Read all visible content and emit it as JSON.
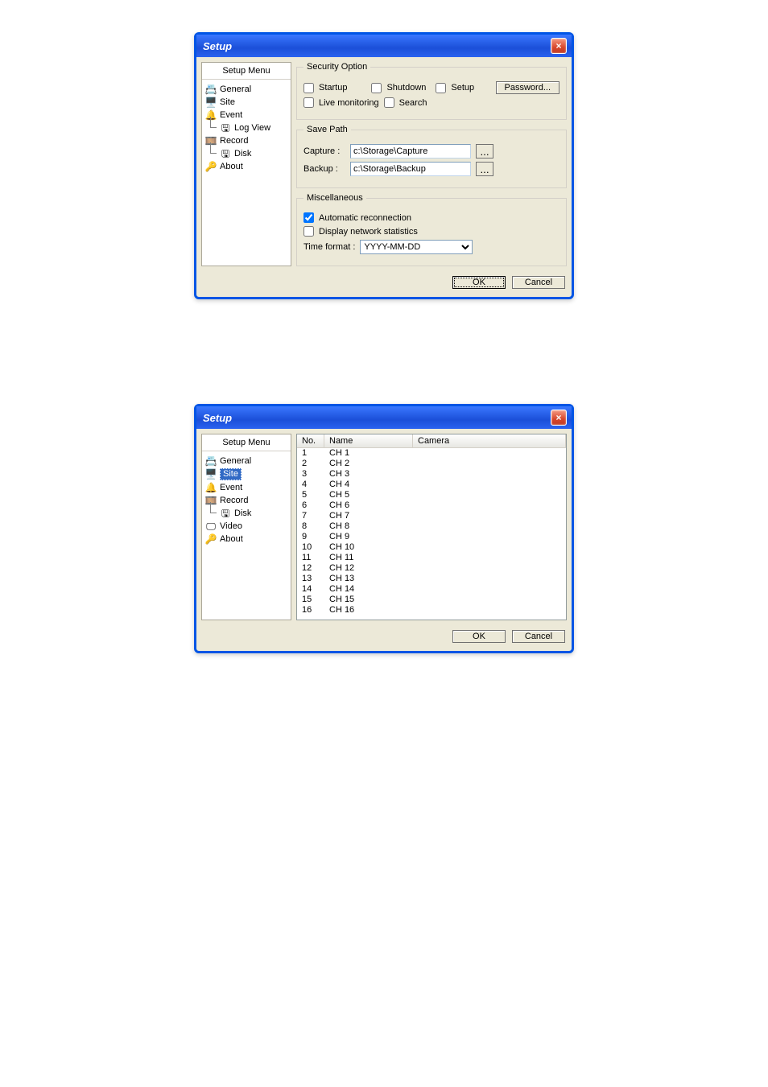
{
  "dialog1": {
    "title": "Setup",
    "sidebar": {
      "title": "Setup Menu",
      "items": [
        {
          "label": "General",
          "icon": "general-icon"
        },
        {
          "label": "Site",
          "icon": "site-icon"
        },
        {
          "label": "Event",
          "icon": "event-icon",
          "children": [
            {
              "label": "Log View",
              "icon": "logview-icon"
            }
          ]
        },
        {
          "label": "Record",
          "icon": "record-icon",
          "children": [
            {
              "label": "Disk",
              "icon": "disk-icon"
            }
          ]
        },
        {
          "label": "About",
          "icon": "about-icon"
        }
      ]
    },
    "security": {
      "legend": "Security Option",
      "startup": "Startup",
      "shutdown": "Shutdown",
      "setup": "Setup",
      "livemon": "Live monitoring",
      "search": "Search",
      "password_btn": "Password..."
    },
    "savepath": {
      "legend": "Save Path",
      "capture_label": "Capture :",
      "capture_value": "c:\\Storage\\Capture",
      "backup_label": "Backup :",
      "backup_value": "c:\\Storage\\Backup",
      "browse": "..."
    },
    "misc": {
      "legend": "Miscellaneous",
      "autoreco": "Automatic reconnection",
      "netstats": "Display network statistics",
      "timeformat_label": "Time format :",
      "timeformat_value": "YYYY-MM-DD"
    },
    "footer": {
      "ok": "OK",
      "cancel": "Cancel"
    }
  },
  "dialog2": {
    "title": "Setup",
    "sidebar": {
      "title": "Setup Menu",
      "selected": "Site",
      "items": [
        {
          "label": "General",
          "icon": "general-icon"
        },
        {
          "label": "Site",
          "icon": "site-icon"
        },
        {
          "label": "Event",
          "icon": "event-icon"
        },
        {
          "label": "Record",
          "icon": "record-icon",
          "children": [
            {
              "label": "Disk",
              "icon": "disk-icon"
            }
          ]
        },
        {
          "label": "Video",
          "icon": "video-icon"
        },
        {
          "label": "About",
          "icon": "about-icon"
        }
      ]
    },
    "list": {
      "columns": {
        "no": "No.",
        "name": "Name",
        "camera": "Camera"
      },
      "rows": [
        {
          "no": "1",
          "name": "CH 1"
        },
        {
          "no": "2",
          "name": "CH 2"
        },
        {
          "no": "3",
          "name": "CH 3"
        },
        {
          "no": "4",
          "name": "CH 4"
        },
        {
          "no": "5",
          "name": "CH 5"
        },
        {
          "no": "6",
          "name": "CH 6"
        },
        {
          "no": "7",
          "name": "CH 7"
        },
        {
          "no": "8",
          "name": "CH 8"
        },
        {
          "no": "9",
          "name": "CH 9"
        },
        {
          "no": "10",
          "name": "CH 10"
        },
        {
          "no": "11",
          "name": "CH 11"
        },
        {
          "no": "12",
          "name": "CH 12"
        },
        {
          "no": "13",
          "name": "CH 13"
        },
        {
          "no": "14",
          "name": "CH 14"
        },
        {
          "no": "15",
          "name": "CH 15"
        },
        {
          "no": "16",
          "name": "CH 16"
        }
      ]
    },
    "footer": {
      "ok": "OK",
      "cancel": "Cancel"
    }
  }
}
